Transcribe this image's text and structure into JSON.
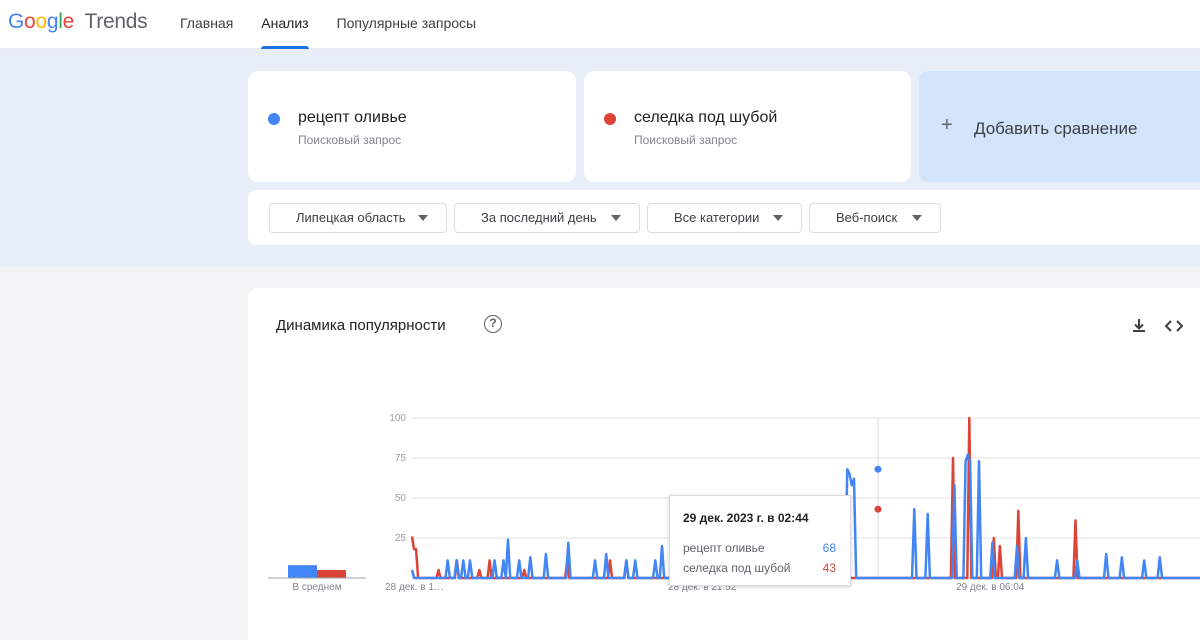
{
  "header": {
    "logo_google": "Google",
    "logo_product": "Trends",
    "nav": [
      {
        "label": "Главная",
        "active": false
      },
      {
        "label": "Анализ",
        "active": true
      },
      {
        "label": "Популярные запросы",
        "active": false
      }
    ]
  },
  "terms": [
    {
      "name": "рецепт оливье",
      "type": "Поисковый запрос",
      "color": "#4285f4"
    },
    {
      "name": "селедка под шубой",
      "type": "Поисковый запрос",
      "color": "#db4437"
    }
  ],
  "add_compare": {
    "label": "Добавить сравнение",
    "icon": "plus-icon"
  },
  "filters": [
    {
      "label": "Липецкая область"
    },
    {
      "label": "За последний день"
    },
    {
      "label": "Все категории"
    },
    {
      "label": "Веб-поиск"
    }
  ],
  "chart_card": {
    "title": "Динамика популярности",
    "icons": [
      "help-icon",
      "download-icon",
      "embed-code-icon"
    ]
  },
  "chart_data": {
    "type": "line",
    "yticks": [
      "100",
      "75",
      "50",
      "25"
    ],
    "ylim": [
      0,
      100
    ],
    "x_tick_labels": [
      "28 дек. в 1…",
      "28 дек. в 21:52",
      "29 дек. в 06:04"
    ],
    "average_label": "В среднем",
    "averages": {
      "рецепт оливье": 8,
      "селедка под шубой": 5
    },
    "grid": true,
    "series": [
      {
        "name": "рецепт оливье",
        "color": "#4285f4",
        "values": [
          5,
          0,
          0,
          0,
          0,
          0,
          0,
          0,
          0,
          0,
          0,
          0,
          0,
          0,
          0,
          0,
          11,
          0,
          0,
          0,
          11,
          0,
          0,
          11,
          0,
          0,
          11,
          0,
          0,
          0,
          0,
          0,
          0,
          0,
          0,
          0,
          0,
          11,
          0,
          0,
          0,
          11,
          0,
          24,
          0,
          0,
          0,
          0,
          11,
          0,
          0,
          0,
          0,
          13,
          0,
          0,
          0,
          0,
          0,
          0,
          15,
          0,
          0,
          0,
          0,
          0,
          0,
          0,
          0,
          0,
          22,
          0,
          0,
          0,
          0,
          0,
          0,
          0,
          0,
          0,
          0,
          0,
          11,
          0,
          0,
          0,
          0,
          15,
          0,
          0,
          0,
          0,
          0,
          0,
          0,
          0,
          11,
          0,
          0,
          0,
          11,
          0,
          0,
          0,
          0,
          0,
          0,
          0,
          0,
          11,
          0,
          0,
          20,
          0,
          0,
          0,
          0,
          0,
          0,
          0,
          0,
          0,
          0,
          0,
          0,
          0,
          0,
          0,
          0,
          0,
          11,
          0,
          0,
          0,
          0,
          0,
          0,
          0,
          0,
          11,
          0,
          0,
          0,
          0,
          13,
          0,
          0,
          0,
          18,
          0,
          0,
          0,
          0,
          0,
          0,
          0,
          0,
          0,
          0,
          0,
          0,
          25,
          0,
          0,
          0,
          0,
          0,
          0,
          0,
          0,
          0,
          0,
          0,
          0,
          0,
          0,
          11,
          0,
          0,
          0,
          0,
          0,
          33,
          0,
          0,
          0,
          0,
          0,
          0,
          0,
          0,
          0,
          0,
          0,
          0,
          68,
          65,
          58,
          62,
          0,
          0,
          0,
          0,
          0,
          0,
          0,
          0,
          0,
          0,
          0,
          0,
          0,
          0,
          0,
          0,
          0,
          0,
          0,
          0,
          0,
          0,
          0,
          0,
          0,
          0,
          43,
          0,
          0,
          0,
          0,
          0,
          40,
          0,
          0,
          0,
          0,
          0,
          0,
          0,
          0,
          0,
          0,
          0,
          58,
          0,
          0,
          0,
          0,
          73,
          77,
          73,
          0,
          0,
          0,
          73,
          0,
          0,
          0,
          0,
          0,
          22,
          0,
          0,
          0,
          0,
          0,
          0,
          0,
          0,
          0,
          0,
          20,
          0,
          0,
          0,
          25,
          0,
          0,
          0,
          0,
          0,
          0,
          0,
          0,
          0,
          0,
          0,
          0,
          0,
          11,
          0,
          0,
          0,
          0,
          0,
          0,
          0,
          0,
          11,
          0,
          0,
          0,
          0,
          0,
          0,
          0,
          0,
          0,
          0,
          0,
          0,
          15,
          0,
          0,
          0,
          0,
          0,
          0,
          13,
          0,
          0,
          0,
          0,
          0,
          0,
          0,
          0,
          0,
          11,
          0,
          0,
          0,
          0,
          0,
          0,
          13,
          0,
          0,
          0,
          0,
          0,
          0,
          0,
          0,
          0,
          0,
          0,
          0,
          0,
          0,
          0,
          0,
          0,
          0
        ]
      },
      {
        "name": "селедка под шубой",
        "color": "#db4437",
        "values": [
          26,
          18,
          18,
          0,
          0,
          0,
          0,
          0,
          0,
          0,
          0,
          0,
          0,
          5,
          0,
          0,
          0,
          0,
          0,
          0,
          0,
          0,
          11,
          0,
          0,
          0,
          0,
          0,
          0,
          0,
          0,
          0,
          0,
          5,
          0,
          0,
          0,
          0,
          11,
          0,
          0,
          0,
          0,
          0,
          0,
          0,
          0,
          0,
          0,
          0,
          0,
          0,
          0,
          0,
          0,
          5,
          0,
          0,
          0,
          0,
          0,
          0,
          0,
          0,
          0,
          0,
          0,
          0,
          0,
          0,
          0,
          0,
          0,
          0,
          0,
          0,
          11,
          0,
          0,
          0,
          0,
          0,
          0,
          0,
          0,
          0,
          0,
          0,
          0,
          0,
          0,
          0,
          0,
          0,
          0,
          0,
          0,
          11,
          0,
          0,
          0,
          0,
          0,
          0,
          0,
          11,
          0,
          0,
          0,
          0,
          0,
          0,
          0,
          0,
          0,
          0,
          0,
          0,
          0,
          0,
          0,
          0,
          0,
          0,
          0,
          0,
          0,
          0,
          0,
          11,
          0,
          0,
          0,
          0,
          0,
          0,
          0,
          0,
          0,
          0,
          0,
          0,
          0,
          11,
          0,
          0,
          0,
          0,
          0,
          0,
          0,
          0,
          0,
          0,
          0,
          0,
          0,
          0,
          0,
          0,
          0,
          0,
          0,
          0,
          0,
          0,
          0,
          0,
          11,
          0,
          0,
          0,
          0,
          0,
          11,
          0,
          0,
          0,
          0,
          0,
          0,
          0,
          0,
          0,
          0,
          11,
          0,
          0,
          0,
          0,
          0,
          0,
          0,
          0,
          0,
          0,
          0,
          0,
          0,
          0,
          0,
          0,
          0,
          0,
          0,
          0,
          43,
          0,
          0,
          0,
          0,
          0,
          0,
          0,
          0,
          0,
          0,
          0,
          0,
          0,
          0,
          0,
          0,
          0,
          0,
          0,
          0,
          0,
          0,
          0,
          0,
          0,
          0,
          0,
          0,
          0,
          0,
          0,
          0,
          0,
          0,
          0,
          0,
          0,
          0,
          0,
          0,
          0,
          0,
          0,
          0,
          0,
          0,
          0,
          0,
          0,
          0,
          0,
          0,
          0,
          0,
          0,
          0,
          0,
          0,
          75,
          0,
          0,
          0,
          0,
          0,
          0,
          0,
          100,
          0,
          0,
          0,
          0,
          0,
          0,
          0,
          0,
          0,
          0,
          0,
          25,
          0,
          0,
          20,
          0,
          0,
          0,
          0,
          0,
          0,
          0,
          0,
          42,
          0,
          0,
          0,
          0,
          0,
          0,
          0,
          0,
          0,
          0,
          0,
          0,
          0,
          0,
          0,
          0,
          0,
          0,
          0,
          0,
          0,
          0,
          0,
          0,
          0,
          0,
          0,
          36,
          0,
          0,
          0,
          0,
          0,
          0,
          0,
          0,
          0,
          0,
          0,
          0,
          0,
          0,
          0,
          0,
          0,
          0,
          0,
          0,
          0,
          0,
          0,
          0,
          0,
          0,
          0,
          0,
          0,
          0,
          0,
          0,
          0,
          0,
          0,
          0,
          0,
          0,
          0,
          0,
          0,
          0,
          0,
          0,
          0,
          0,
          0,
          0,
          0,
          0,
          0,
          0,
          0,
          0,
          0,
          0,
          0,
          0,
          0,
          0,
          0
        ]
      }
    ],
    "tooltip": {
      "date": "29 дек. 2023 г. в 02:44",
      "rows": [
        {
          "name": "рецепт оливье",
          "value": "68",
          "color": "#4285f4"
        },
        {
          "name": "селедка под шубой",
          "value": "43",
          "color": "#db4437"
        }
      ]
    }
  }
}
